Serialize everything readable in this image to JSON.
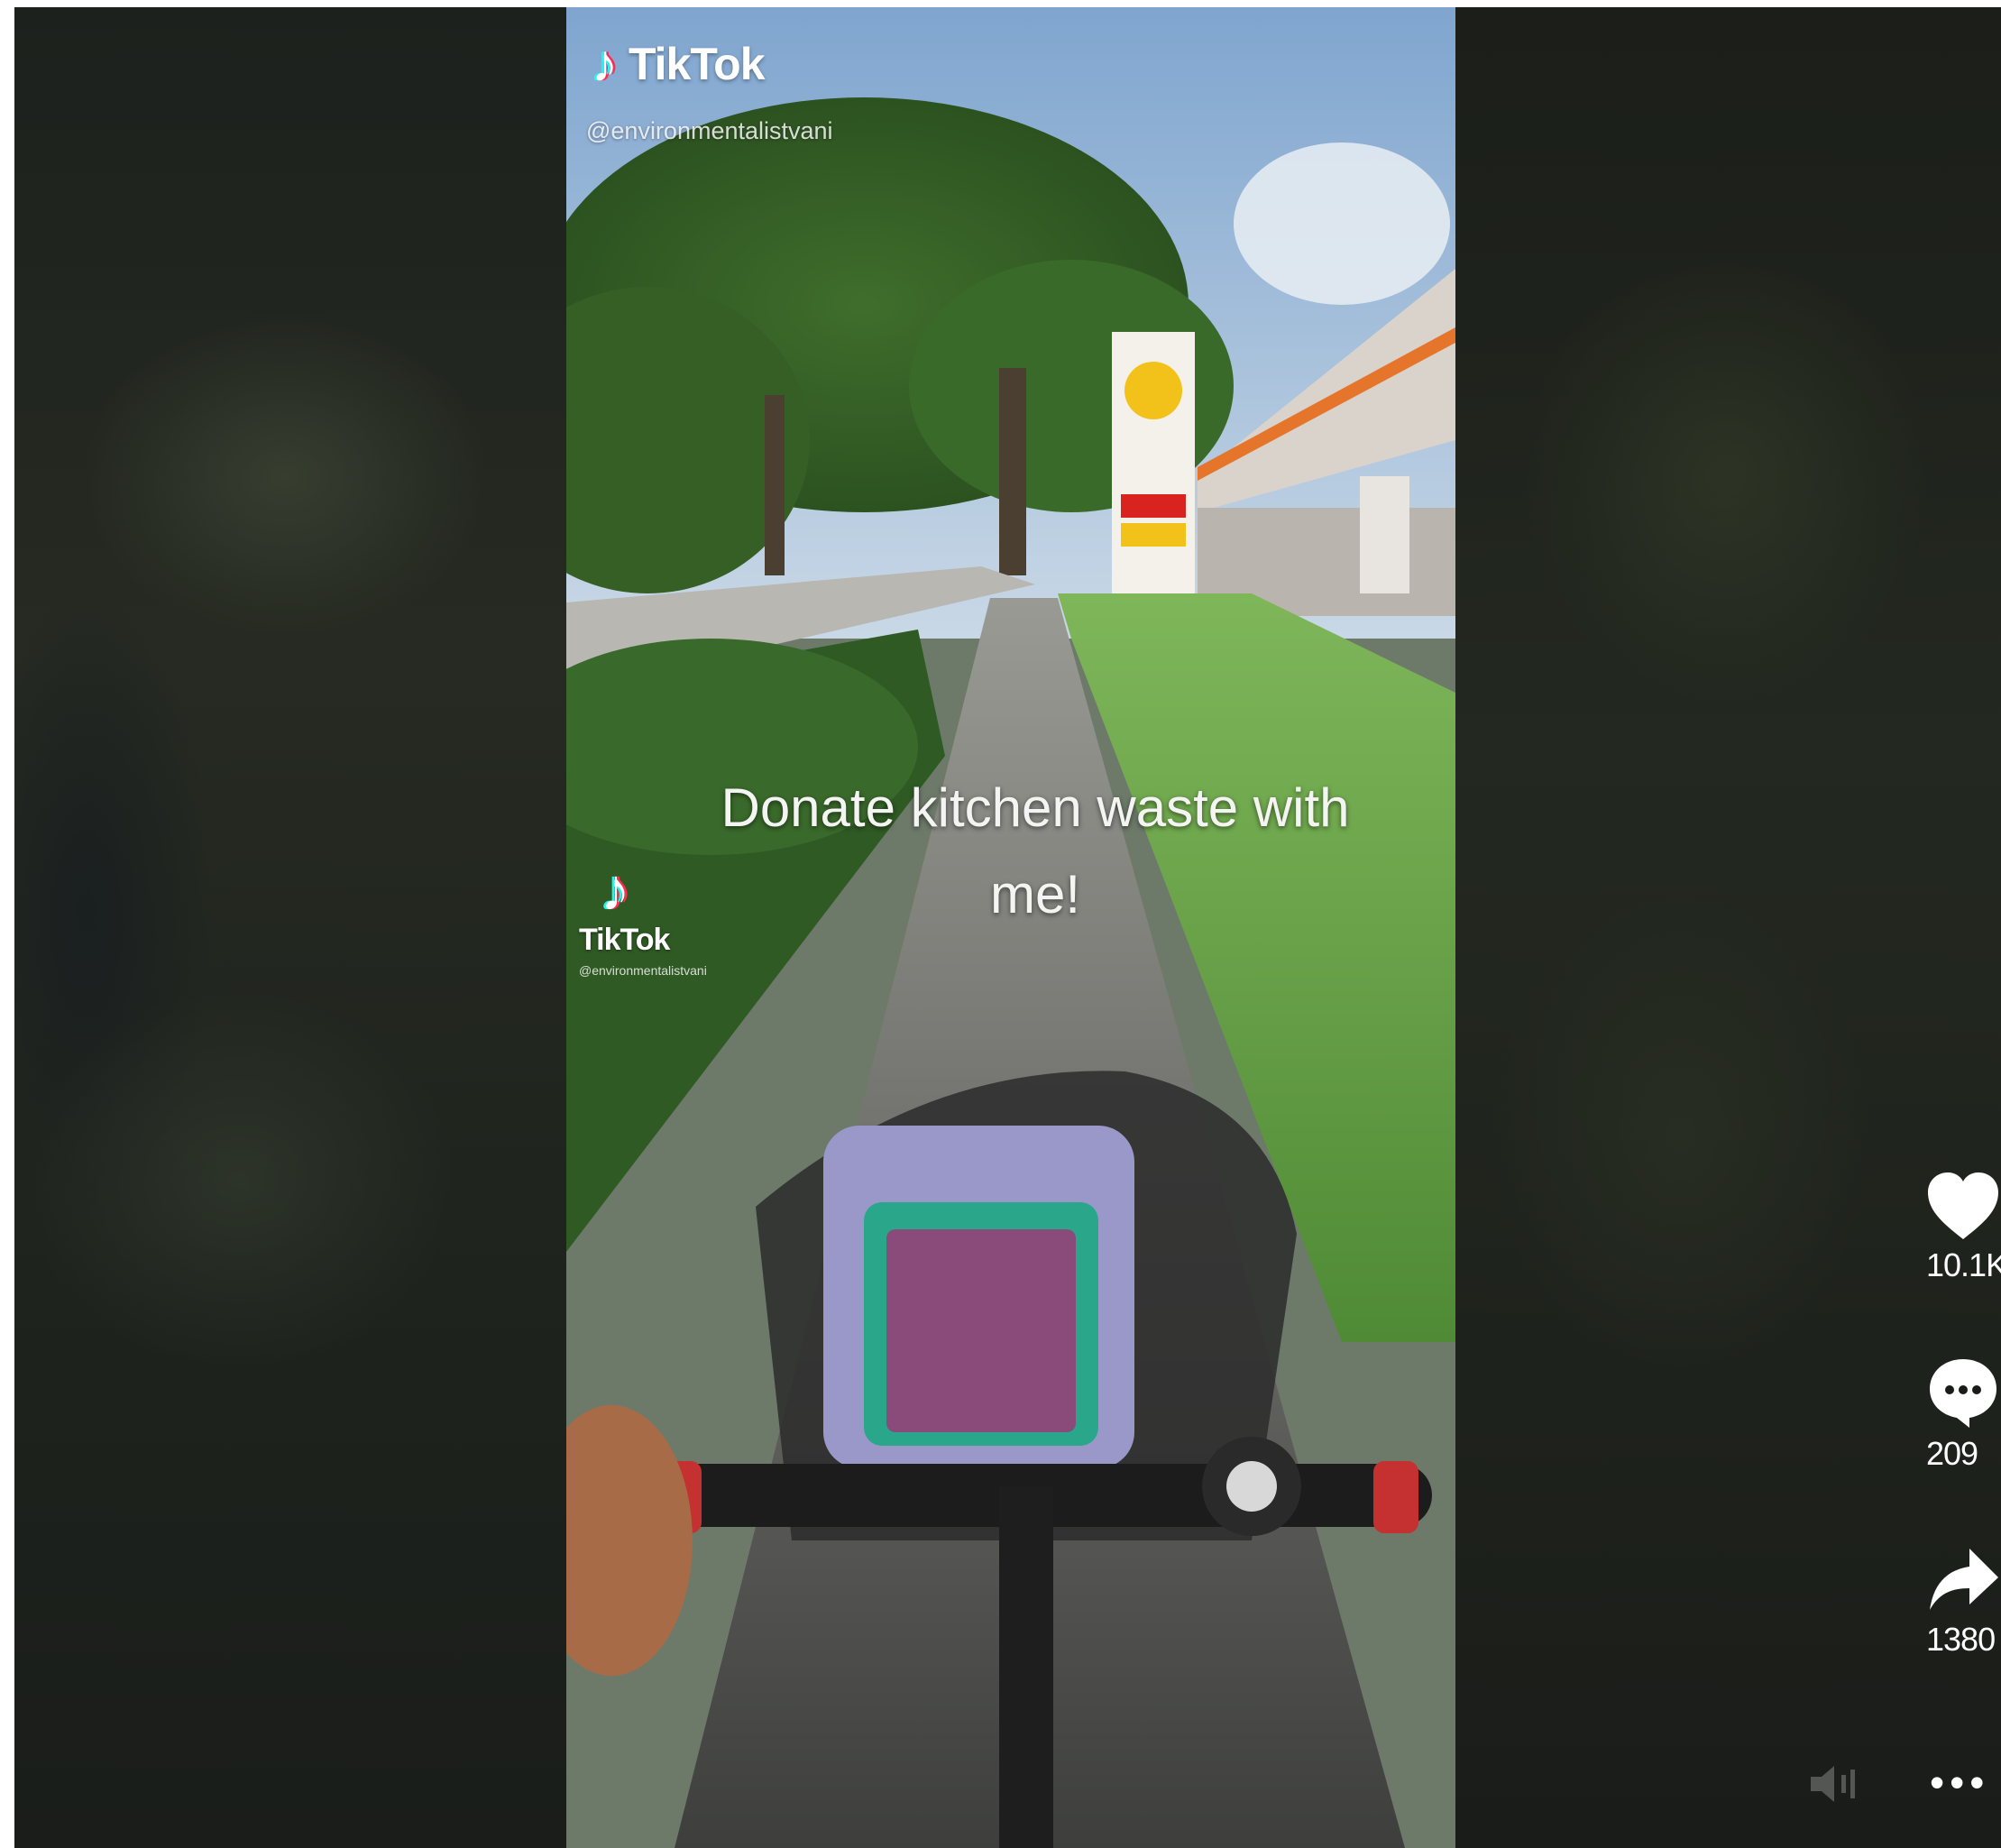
{
  "video": {
    "watermark_brand": "TikTok",
    "watermark_handle": "@environmentalistvani",
    "caption_line1": "Donate kitchen waste with",
    "caption_line2": "me!"
  },
  "actions": {
    "likes": "10.1K",
    "comments": "209",
    "shares": "1380",
    "more": "•••"
  },
  "icons": {
    "like": "heart-icon",
    "comment": "comment-icon",
    "share": "share-icon",
    "more": "more-icon",
    "volume": "volume-icon"
  },
  "colors": {
    "tiktok_cyan": "#25f4ee",
    "tiktok_red": "#fe2c55",
    "background": "#131512"
  }
}
